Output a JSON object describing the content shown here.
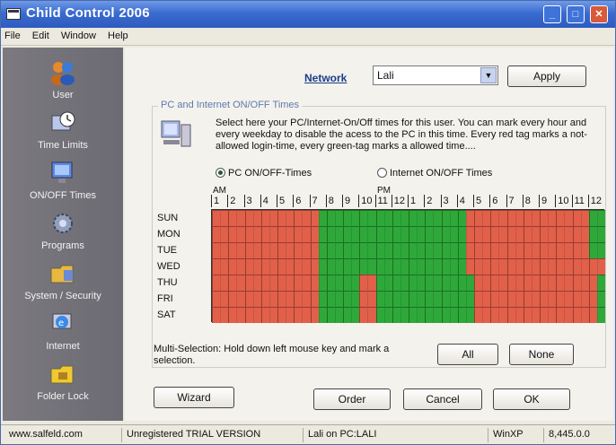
{
  "window": {
    "title": "Child Control 2006"
  },
  "menu": [
    "File",
    "Edit",
    "Window",
    "Help"
  ],
  "sidebar": {
    "items": [
      {
        "label": "User",
        "icon": "users-icon"
      },
      {
        "label": "Time Limits",
        "icon": "clock-icon"
      },
      {
        "label": "ON/OFF Times",
        "icon": "monitor-icon"
      },
      {
        "label": "Programs",
        "icon": "gear-icon"
      },
      {
        "label": "System / Security",
        "icon": "folder-icon"
      },
      {
        "label": "Internet",
        "icon": "globe-icon"
      },
      {
        "label": "Folder Lock",
        "icon": "lock-folder-icon"
      }
    ]
  },
  "network": {
    "label": "Network",
    "value": "Lali",
    "apply_label": "Apply"
  },
  "group": {
    "title": "PC and Internet ON/OFF Times",
    "description": "Select here your PC/Internet-On/Off times for this user. You can mark every hour and every weekday to disable the acess to the PC in this time. Every red tag marks a not-allowed login-time, every green-tag marks a allowed time....",
    "radio_pc": "PC ON/OFF-Times",
    "radio_internet": "Internet ON/OFF Times",
    "selected_radio": "pc",
    "am": "AM",
    "pm": "PM",
    "hours": [
      "1",
      "2",
      "3",
      "4",
      "5",
      "6",
      "7",
      "8",
      "9",
      "10",
      "11",
      "12",
      "1",
      "2",
      "3",
      "4",
      "5",
      "6",
      "7",
      "8",
      "9",
      "10",
      "11",
      "12"
    ],
    "days": [
      "SUN",
      "MON",
      "TUE",
      "WED",
      "THU",
      "FRI",
      "SAT"
    ],
    "schedule": [
      "rrrrrrrrrrrrrggggggggggggggggggrrrrrrrrrrrrrrrggggggggggggggggggggggggggggggggggggggggggggggggggg",
      "rrrrrrrrrrrrrggggggggggggggggggrrrrrrrrrrrrrrrggggggggggggggggggggggggggggggggggggggggggggggggggg",
      "rrrrrrrrrrrrrggggggggggggggggggrrrrrrrrrrrrrrrggggggggggggggggggggggggggggggggggggggggggggggggggg",
      "rrrrrrrrrrrrrggggggggggggggggggrrrrrrrrrrrrrrrrrrrgggggggggggggggggggggggggggggggggggggggggggggggg",
      "rrrrrrrrrrrrrgggggrrggggggggggggrrrrrrrrrrrrrrrggggggggggggggggggggggggggggggggggggggggggggggggggg",
      "rrrrrrrrrrrrrgggggrrggggggggggggrrrrrrrrrrrrrrrggggggggggggggggggggggggggggggggggggggggggggggggggg",
      "rrrrrrrrrrrrrgggggrrggggggggggggrrrrrrrrrrrrrrrggggggggggggggggggggggggggggggggggggggggggggggggggg"
    ],
    "multi_selection": "Multi-Selection: Hold down left mouse key and mark a selection.",
    "all_label": "All",
    "none_label": "None"
  },
  "buttons": {
    "wizard": "Wizard",
    "order": "Order",
    "cancel": "Cancel",
    "ok": "OK"
  },
  "status": {
    "site": "www.salfeld.com",
    "trial": "Unregistered TRIAL VERSION",
    "user": "Lali on PC:LALI",
    "os": "WinXP",
    "version": "8,445.0.0"
  },
  "colors": {
    "on": "#e2604a",
    "off": "#2fa83a",
    "title": "#3a6bd0"
  }
}
